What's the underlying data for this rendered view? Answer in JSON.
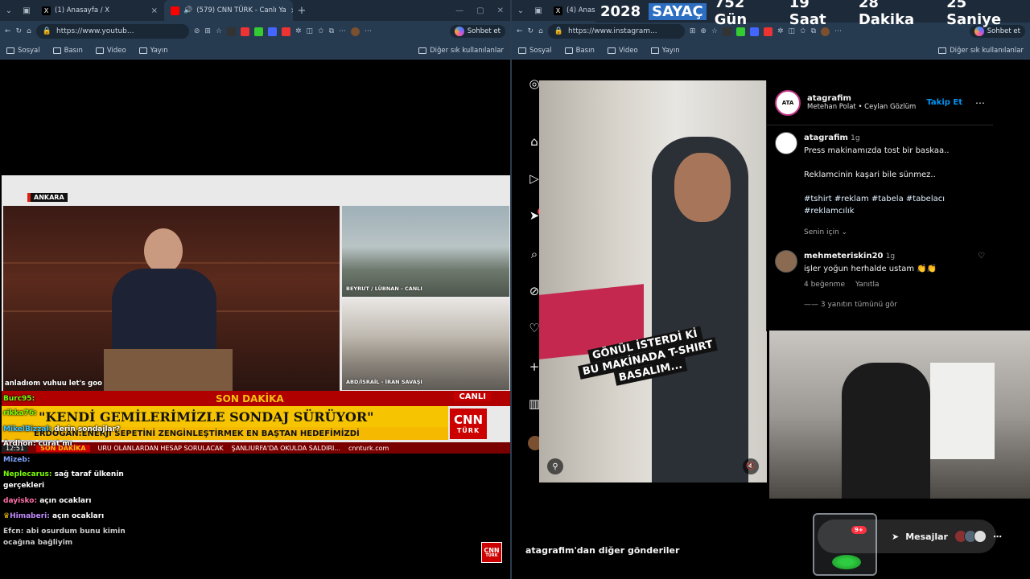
{
  "left_window": {
    "tabs": [
      {
        "title": "(1) Anasayfa / X"
      },
      {
        "title": "(579) CNN TÜRK - Canlı Ya"
      }
    ],
    "url": "https://www.youtub...",
    "copilot_label": "Sohbet et",
    "bookmarks": [
      "Sosyal",
      "Basın",
      "Video",
      "Yayın"
    ],
    "other_bookmarks": "Diğer sık kullanılanlar"
  },
  "right_window": {
    "tab_title": "(4) Anas",
    "url": "https://www.instagram...",
    "copilot_label": "Sohbet et",
    "bookmarks": [
      "Sosyal",
      "Basın",
      "Video",
      "Yayın"
    ],
    "other_bookmarks": "Diğer sık kullanılanlar"
  },
  "counter": {
    "year": "2028",
    "label": "SAYAÇ",
    "days": "752 Gün",
    "hours": "19 Saat",
    "minutes": "28 Dakika",
    "seconds": "25 Saniye"
  },
  "news": {
    "location": "ANKARA",
    "side_labels": [
      "BEYRUT / LÜBNAN - CANLI",
      "ABD/İSRAİL - İRAN SAVAŞI"
    ],
    "breaking_label": "SON DAKİKA",
    "live_label": "CANLI",
    "headline": "\"KENDİ GEMİLERİMİZLE SONDAJ SÜRÜYOR\"",
    "subheadline": "ERDOĞAN:ENERJİ SEPETİNİ ZENGİNLEŞTİRMEK EN BAŞTAN HEDEFİMİZDİ",
    "logo_text": "CNN",
    "logo_sub": "TÜRK",
    "ticker_time": "12:51",
    "ticker_label": "SON DAKİKA",
    "ticker_items": [
      "URU OLANLARDAN HESAP SORULACAK",
      "ŞANLIURFA'DA OKULDA SALDIRI...",
      "cnnturk.com"
    ],
    "speech_caption": "anladıom vuhuu let's goo"
  },
  "chat": [
    {
      "user": "Burc95:",
      "text": "",
      "color": "#7CFC00"
    },
    {
      "user": "rikka76:",
      "text": "",
      "color": "#7CFC00"
    },
    {
      "user": "MikelBizzal:",
      "text": "derin sondajlar?",
      "color": "#40c4ff"
    },
    {
      "user": "Ardhon:",
      "text": "curat mı",
      "color": "#ffffff"
    },
    {
      "user": "Mizeb:",
      "text": "",
      "color": "#7fa3ff"
    },
    {
      "user": "Neplecarus:",
      "text": "sağ taraf ülkenin",
      "color": "#7CFC00"
    },
    {
      "user": "",
      "text": "gerçekleri",
      "color": "#ffffff"
    },
    {
      "user": "dayisko:",
      "text": "açın ocakları",
      "color": "#ff6fa8"
    },
    {
      "user": "Himaberi:",
      "text": "açın ocakları",
      "color": "#c18cff"
    },
    {
      "user": "Efcn:",
      "text": "abi osurdum bunu kimin",
      "color": "#cccccc"
    },
    {
      "user": "",
      "text": "ocağına bağliyim",
      "color": "#cccccc"
    }
  ],
  "instagram": {
    "nav_badge": "9+",
    "video_caption": [
      "GÖNÜL İSTERDİ Kİ",
      "BU MAKİNADA T-SHIRT",
      "BASALIM..."
    ],
    "post": {
      "username": "atagrafim",
      "coauthors": "Metehan Polat • Ceylan Gözlüm",
      "follow_label": "Takip Et",
      "caption_user": "atagrafim",
      "caption_time": "1g",
      "caption_line1": "Press makinamızda tost bir baskaa..",
      "caption_line2": "Reklamcinin kaşari bile sünmez..",
      "hashtags": "#tshirt #reklam #tabela #tabelacı #reklamcılık",
      "translation_label": "Senin için",
      "comment_user": "mehmeteriskin20",
      "comment_time": "1g",
      "comment_text": "işler yoğun herhalde ustam 👏👏",
      "comment_likes": "4 beğenme",
      "reply_label": "Yanıtla",
      "view_replies": "3 yanıtın tümünü gör"
    },
    "more_posts_label": "atagrafim'dan diğer gönderiler",
    "messages_label": "Mesajlar",
    "messages_badge": "9+"
  }
}
